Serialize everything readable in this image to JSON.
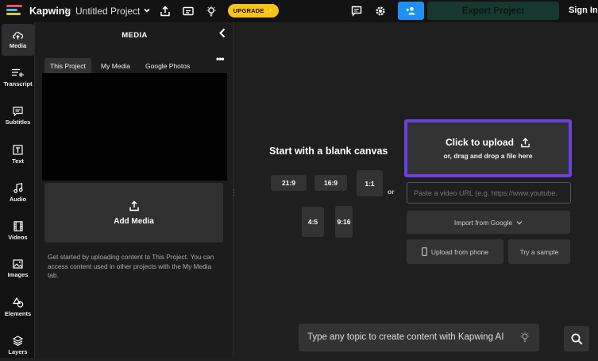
{
  "colors": {
    "accent_blue": "#1f8ff5",
    "upgrade_yellow": "#f7c317",
    "upload_border": "#6a40e0",
    "export_bg": "#17382e"
  },
  "topbar": {
    "brand": "Kapwing",
    "separator": ">",
    "project_title": "Untitled Project",
    "upgrade_label": "UPGRADE ✨",
    "export_label": "Export Project",
    "signin_label": "Sign In"
  },
  "rail": [
    {
      "label": "Media",
      "icon": "upload-cloud-icon"
    },
    {
      "label": "Transcript",
      "icon": "transcript-icon"
    },
    {
      "label": "Subtitles",
      "icon": "subtitles-icon"
    },
    {
      "label": "Text",
      "icon": "text-icon"
    },
    {
      "label": "Audio",
      "icon": "music-note-icon"
    },
    {
      "label": "Videos",
      "icon": "film-icon"
    },
    {
      "label": "Images",
      "icon": "image-icon"
    },
    {
      "label": "Elements",
      "icon": "shapes-icon"
    },
    {
      "label": "Layers",
      "icon": "layers-icon"
    }
  ],
  "panel": {
    "title": "MEDIA",
    "tabs": [
      "This Project",
      "My Media",
      "Google Photos"
    ],
    "add_media_label": "Add Media",
    "help_text": "Get started by uploading content to This Project. You can access content used in other projects with the My Media tab."
  },
  "canvas": {
    "blank_title": "Start with a blank canvas",
    "ratios": [
      "21:9",
      "16:9",
      "1:1",
      "4:5",
      "9:16"
    ],
    "or_label": "or",
    "upload_title": "Click to upload",
    "upload_sub": "or, drag and drop a file here",
    "url_placeholder": "Paste a video URL (e.g. https://www.youtube.",
    "import_google": "Import from Google",
    "upload_phone": "Upload from phone",
    "try_sample": "Try a sample",
    "ai_placeholder": "Type any topic to create content with Kapwing AI"
  }
}
